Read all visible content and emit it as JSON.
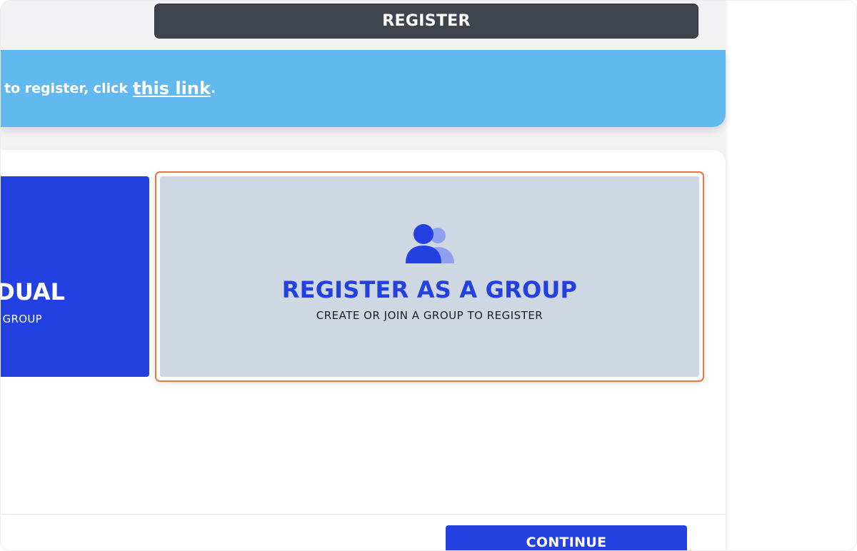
{
  "header": {
    "register_label": "REGISTER"
  },
  "notice": {
    "text": "to register, click",
    "link_text": "this link",
    "end_punct": "."
  },
  "options": {
    "individual": {
      "title_visible": "DUAL",
      "subtitle_visible": "GROUP"
    },
    "group": {
      "title": "REGISTER AS A GROUP",
      "subtitle": "CREATE OR JOIN A GROUP TO REGISTER",
      "icon": "users-icon",
      "selected": true
    }
  },
  "footer": {
    "continue_label": "CONTINUE"
  },
  "colors": {
    "brand_blue": "#2340e0",
    "notice_bg": "#62b9ef",
    "header_bar": "#40444e",
    "selected_outline": "#f2743a",
    "group_card_bg": "#ced7e2"
  }
}
